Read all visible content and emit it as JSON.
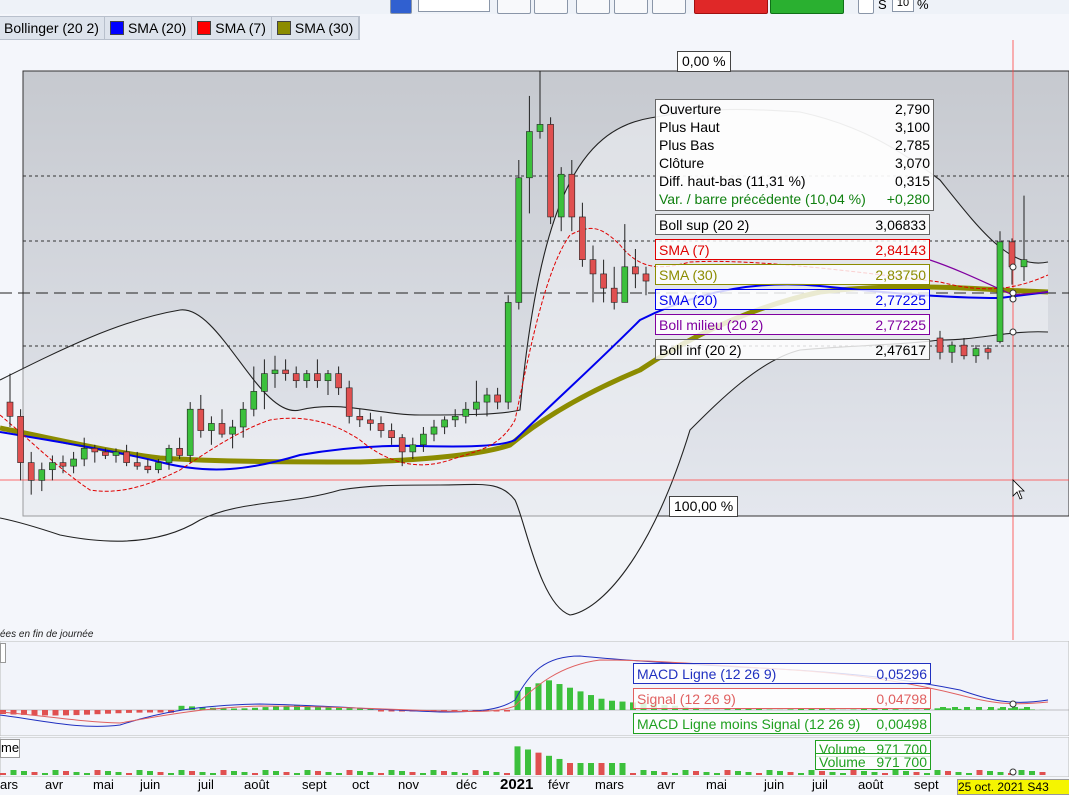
{
  "toolbar": {
    "input_value": "10",
    "s_label": "S",
    "s_value": "10",
    "percent_label": "%"
  },
  "legend": [
    {
      "label": "Bollinger (20 2)",
      "color": "#dde3ec"
    },
    {
      "label": "SMA (20)",
      "color": "#0000ff"
    },
    {
      "label": "SMA (7)",
      "color": "#ff0000"
    },
    {
      "label": "SMA (30)",
      "color": "#8c8c00"
    }
  ],
  "labels": {
    "pct_top": "0,00 %",
    "pct_bottom": "100,00 %",
    "end_of_day": "ées en fin de journée",
    "volume_tab": "me",
    "date_readout": "25 oct. 2021 S43"
  },
  "info": {
    "rows": [
      {
        "label": "Ouverture",
        "value": "2,790"
      },
      {
        "label": "Plus Haut",
        "value": "3,100"
      },
      {
        "label": "Plus Bas",
        "value": "2,785"
      },
      {
        "label": "Clôture",
        "value": "3,070"
      },
      {
        "label": "Diff. haut-bas (11,31 %)",
        "value": "0,315"
      },
      {
        "label": "Var. / barre précédente (10,04 %)",
        "value": "+0,280"
      }
    ],
    "indicators": [
      {
        "label": "Boll sup (20 2)",
        "value": "3,06833",
        "color": "#000000"
      },
      {
        "label": "SMA (7)",
        "value": "2,84143",
        "color": "#e00000"
      },
      {
        "label": "SMA (30)",
        "value": "2,83750",
        "color": "#8c8c00"
      },
      {
        "label": "SMA (20)",
        "value": "2,77225",
        "color": "#0000ee"
      },
      {
        "label": "Boll milieu (20 2)",
        "value": "2,77225",
        "color": "#8000a0"
      },
      {
        "label": "Boll inf (20 2)",
        "value": "2,47617",
        "color": "#000000"
      }
    ]
  },
  "macd": [
    {
      "label": "MACD Ligne (12 26 9)",
      "value": "0,05296",
      "color": "#2030c0"
    },
    {
      "label": "Signal (12 26 9)",
      "value": "0,04798",
      "color": "#e06060"
    },
    {
      "label": "MACD Ligne moins Signal (12 26 9)",
      "value": "0,00498",
      "color": "#20a020"
    }
  ],
  "volume_labels": [
    {
      "label": "Volume",
      "value": "971 700"
    },
    {
      "label": "Volume",
      "value": "971 700"
    }
  ],
  "months": [
    "ars",
    "avr",
    "mai",
    "juin",
    "juil",
    "août",
    "sept",
    "oct",
    "nov",
    "déc",
    "2021",
    "févr",
    "mars",
    "avr",
    "mai",
    "juin",
    "juil",
    "août",
    "sept"
  ],
  "chart_data": {
    "type": "candlestick",
    "candles": [
      [
        2.62,
        2.7,
        2.55,
        2.58
      ],
      [
        2.58,
        2.6,
        2.4,
        2.45
      ],
      [
        2.45,
        2.48,
        2.36,
        2.4
      ],
      [
        2.4,
        2.45,
        2.37,
        2.43
      ],
      [
        2.43,
        2.47,
        2.4,
        2.45
      ],
      [
        2.45,
        2.47,
        2.42,
        2.44
      ],
      [
        2.44,
        2.48,
        2.42,
        2.46
      ],
      [
        2.46,
        2.52,
        2.44,
        2.49
      ],
      [
        2.49,
        2.5,
        2.45,
        2.48
      ],
      [
        2.48,
        2.49,
        2.46,
        2.47
      ],
      [
        2.47,
        2.49,
        2.45,
        2.48
      ],
      [
        2.48,
        2.5,
        2.44,
        2.45
      ],
      [
        2.45,
        2.48,
        2.43,
        2.44
      ],
      [
        2.44,
        2.46,
        2.42,
        2.43
      ],
      [
        2.43,
        2.46,
        2.42,
        2.45
      ],
      [
        2.45,
        2.5,
        2.43,
        2.49
      ],
      [
        2.49,
        2.52,
        2.46,
        2.47
      ],
      [
        2.47,
        2.62,
        2.45,
        2.6
      ],
      [
        2.6,
        2.64,
        2.52,
        2.54
      ],
      [
        2.54,
        2.58,
        2.5,
        2.56
      ],
      [
        2.56,
        2.6,
        2.52,
        2.53
      ],
      [
        2.53,
        2.57,
        2.49,
        2.55
      ],
      [
        2.55,
        2.62,
        2.52,
        2.6
      ],
      [
        2.6,
        2.72,
        2.58,
        2.65
      ],
      [
        2.65,
        2.74,
        2.6,
        2.7
      ],
      [
        2.7,
        2.75,
        2.66,
        2.71
      ],
      [
        2.71,
        2.74,
        2.68,
        2.7
      ],
      [
        2.7,
        2.72,
        2.66,
        2.68
      ],
      [
        2.68,
        2.71,
        2.66,
        2.7
      ],
      [
        2.7,
        2.74,
        2.66,
        2.68
      ],
      [
        2.68,
        2.71,
        2.64,
        2.7
      ],
      [
        2.7,
        2.72,
        2.64,
        2.66
      ],
      [
        2.66,
        2.68,
        2.56,
        2.58
      ],
      [
        2.58,
        2.6,
        2.55,
        2.57
      ],
      [
        2.57,
        2.59,
        2.54,
        2.56
      ],
      [
        2.56,
        2.58,
        2.52,
        2.54
      ],
      [
        2.54,
        2.56,
        2.5,
        2.52
      ],
      [
        2.52,
        2.53,
        2.44,
        2.48
      ],
      [
        2.48,
        2.52,
        2.46,
        2.5
      ],
      [
        2.5,
        2.55,
        2.48,
        2.53
      ],
      [
        2.53,
        2.57,
        2.51,
        2.55
      ],
      [
        2.55,
        2.58,
        2.53,
        2.57
      ],
      [
        2.57,
        2.6,
        2.55,
        2.58
      ],
      [
        2.58,
        2.62,
        2.56,
        2.6
      ],
      [
        2.6,
        2.68,
        2.58,
        2.62
      ],
      [
        2.62,
        2.66,
        2.58,
        2.64
      ],
      [
        2.64,
        2.66,
        2.6,
        2.62
      ],
      [
        2.62,
        2.92,
        2.6,
        2.9
      ],
      [
        2.9,
        3.3,
        2.88,
        3.25
      ],
      [
        3.25,
        3.48,
        3.15,
        3.38
      ],
      [
        3.38,
        3.55,
        3.36,
        3.4
      ],
      [
        3.4,
        3.42,
        3.12,
        3.14
      ],
      [
        3.14,
        3.28,
        3.1,
        3.26
      ],
      [
        3.26,
        3.3,
        3.1,
        3.14
      ],
      [
        3.14,
        3.18,
        3.0,
        3.02
      ],
      [
        3.02,
        3.06,
        2.9,
        2.98
      ],
      [
        2.98,
        3.02,
        2.9,
        2.94
      ],
      [
        2.94,
        3.0,
        2.88,
        2.9
      ],
      [
        2.9,
        3.12,
        2.9,
        3.0
      ],
      [
        3.0,
        3.05,
        2.94,
        2.98
      ],
      [
        2.98,
        3.0,
        2.92,
        2.96
      ]
    ],
    "ylim": [
      2.3,
      3.55
    ]
  }
}
